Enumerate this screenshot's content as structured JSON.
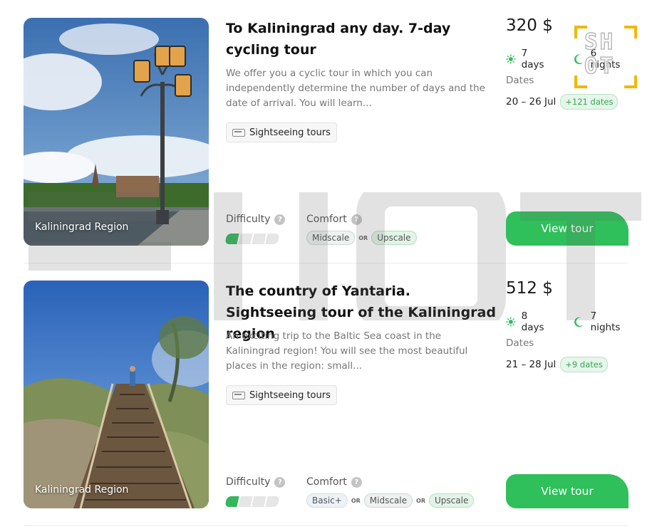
{
  "tours": [
    {
      "region": "Kaliningrad Region",
      "title": "To Kaliningrad any day. 7-day cycling tour",
      "description": "We offer you a cyclic tour in which you can independently determine the number of days and the date of arrival.  You will learn...",
      "tag": "Sightseeing tours",
      "difficulty_label": "Difficulty",
      "difficulty_level": 1,
      "difficulty_max": 4,
      "comfort_label": "Comfort",
      "comfort_options": [
        "Midscale",
        "Upscale"
      ],
      "or_label": "OR",
      "price": "320 $",
      "days": "7 days",
      "nights": "6 nights",
      "dates_label": "Dates",
      "dates": "20 – 26 Jul",
      "more_dates": "+121 dates",
      "cta": "View tour"
    },
    {
      "region": "Kaliningrad Region",
      "title": "The country of Yantaria. Sightseeing tour of the Kaliningrad region",
      "description": "An exciting trip to the Baltic Sea coast in the Kaliningrad region! You will see the most beautiful places in the region: small...",
      "tag": "Sightseeing tours",
      "difficulty_label": "Difficulty",
      "difficulty_level": 1,
      "difficulty_max": 4,
      "comfort_label": "Comfort",
      "comfort_options": [
        "Basic+",
        "Midscale",
        "Upscale"
      ],
      "or_label": "OR",
      "price": "512 $",
      "days": "8 days",
      "nights": "7 nights",
      "dates_label": "Dates",
      "dates": "21 – 28 Jul",
      "more_dates": "+9 dates",
      "cta": "View tour"
    }
  ],
  "logo_text": [
    "SH",
    "OT"
  ],
  "colors": {
    "accent": "#2fbf5b",
    "logo": "#f2b705"
  }
}
